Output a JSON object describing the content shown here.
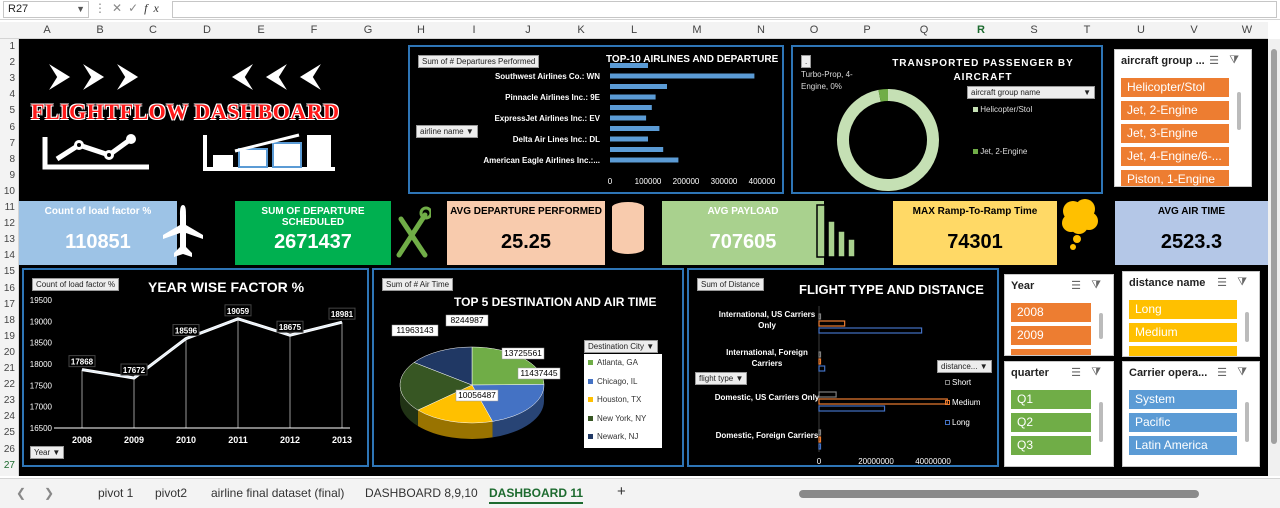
{
  "formula_bar": {
    "name_box": "R27",
    "fx": "fx"
  },
  "columns": [
    "A",
    "B",
    "C",
    "D",
    "E",
    "F",
    "G",
    "H",
    "I",
    "J",
    "K",
    "L",
    "M",
    "N",
    "O",
    "P",
    "Q",
    "R",
    "S",
    "T",
    "U",
    "V",
    "W"
  ],
  "rows": [
    "1",
    "2",
    "3",
    "4",
    "5",
    "6",
    "7",
    "8",
    "9",
    "10",
    "11",
    "12",
    "13",
    "14",
    "15",
    "16",
    "17",
    "18",
    "19",
    "20",
    "21",
    "22",
    "23",
    "24",
    "25",
    "26",
    "27"
  ],
  "tabs": [
    "pivot 1",
    "pivot2",
    "airline final dataset (final)",
    "DASHBOARD 8,9,10",
    "DASHBOARD 11"
  ],
  "active_tab": "DASHBOARD 11",
  "title": "FLIGHTFLOW DASHBOARD",
  "arrows_right": ">>>",
  "arrows_left": "<<<",
  "kpis": [
    {
      "title": "Count of load factor %",
      "value": "110851",
      "bg": "#9dc3e6",
      "fg": "#ffffff"
    },
    {
      "title": "SUM OF DEPARTURE SCHEDULED",
      "value": "2671437",
      "bg": "#00b050",
      "fg": "#ffffff"
    },
    {
      "title": "AVG DEPARTURE PERFORMED",
      "value": "25.25",
      "bg": "#f8cbad",
      "fg": "#000000"
    },
    {
      "title": "AVG PAYLOAD",
      "value": "707605",
      "bg": "#a9d18e",
      "fg": "#ffffff"
    },
    {
      "title": "MAX Ramp-To-Ramp Time",
      "value": "74301",
      "bg": "#ffd966",
      "fg": "#000000"
    },
    {
      "title": "AVG AIR TIME",
      "value": "2523.3",
      "bg": "#b4c7e7",
      "fg": "#000000"
    }
  ],
  "top10": {
    "field_button": "Sum of # Departures Performed",
    "filter_button": "airline name",
    "chart_data": {
      "type": "bar",
      "title": "TOP-10 AIRLINES AND DEPARTURE",
      "categories": [
        "Southwest Airlines Co.: WN",
        "Pinnacle Airlines Inc.: 9E",
        "ExpressJet Airlines Inc.: EV",
        "Delta Air Lines Inc.: DL",
        "American Eagle Airlines Inc.:..."
      ],
      "bars": [
        100000,
        380000,
        150000,
        120000,
        110000,
        95000,
        130000,
        100000,
        140000,
        180000
      ],
      "xticks": [
        "0",
        "100000",
        "200000",
        "300000",
        "400000"
      ],
      "xlim": [
        0,
        400000
      ]
    }
  },
  "donut": {
    "field_button": ".",
    "legend_button": "aircraft group name",
    "chart_data": {
      "type": "pie",
      "title": "TRANSPORTED PASSENGER BY AIRCRAFT",
      "annotation": "Turbo-Prop, 4-Engine, 0%",
      "legend": [
        "Helicopter/Stol",
        "Jet, 2-Engine"
      ],
      "colors": [
        "#c5e0b4",
        "#70ad47"
      ],
      "values": [
        97,
        3
      ]
    }
  },
  "year_chart": {
    "field_button": "Count of load factor %",
    "axis_button": "Year",
    "chart_data": {
      "type": "line",
      "title": "YEAR WISE FACTOR %",
      "x": [
        "2008",
        "2009",
        "2010",
        "2011",
        "2012",
        "2013"
      ],
      "y": [
        17868,
        17672,
        18596,
        19059,
        18675,
        18981
      ],
      "ylim": [
        16500,
        19500
      ],
      "yticks": [
        "19500",
        "19000",
        "18500",
        "18000",
        "17500",
        "17000",
        "16500"
      ]
    }
  },
  "pie3d": {
    "field_button": "Sum of # Air Time",
    "legend_button": "Destination City",
    "chart_data": {
      "type": "pie",
      "title": "TOP 5 DESTINATION AND AIR TIME",
      "categories": [
        "Atlanta, GA",
        "Chicago, IL",
        "Houston, TX",
        "New York, NY",
        "Newark, NJ"
      ],
      "values": [
        13725561,
        11437445,
        10056487,
        11963143,
        8244987
      ],
      "colors": [
        "#70ad47",
        "#4472c4",
        "#ffc000",
        "#375623",
        "#203864"
      ]
    }
  },
  "flight": {
    "field_button": "Sum of Distance",
    "axis_button": "flight type",
    "legend_button": "distance...",
    "chart_data": {
      "type": "bar",
      "title": "FLIGHT TYPE AND DISTANCE",
      "categories": [
        "International, US Carriers Only",
        "International, Foreign Carriers",
        "Domestic, US Carriers Only",
        "Domestic, Foreign Carriers"
      ],
      "series": [
        {
          "name": "Short",
          "values": [
            200000,
            300000,
            6000000,
            200000
          ],
          "color": "#7f7f7f"
        },
        {
          "name": "Medium",
          "values": [
            9000000,
            500000,
            45000000,
            500000
          ],
          "color": "#ed7d31"
        },
        {
          "name": "Long",
          "values": [
            36000000,
            2000000,
            23000000,
            300000
          ],
          "color": "#4472c4"
        }
      ],
      "xticks": [
        "0",
        "20000000",
        "40000000"
      ],
      "xlim": [
        0,
        40000000
      ]
    }
  },
  "slicers": [
    {
      "header": "aircraft group ...",
      "items": [
        "Helicopter/Stol",
        "Jet, 2-Engine",
        "Jet, 3-Engine",
        "Jet, 4-Engine/6-...",
        "Piston, 1-Engine"
      ],
      "color": "#ed7d31"
    },
    {
      "header": "Year",
      "items": [
        "2008",
        "2009",
        ""
      ],
      "color": "#ed7d31"
    },
    {
      "header": "distance name",
      "items": [
        "Long",
        "Medium",
        ""
      ],
      "color": "#ffc000"
    },
    {
      "header": "quarter",
      "items": [
        "Q1",
        "Q2",
        "Q3"
      ],
      "color": "#70ad47"
    },
    {
      "header": "Carrier opera...",
      "items": [
        "System",
        "Pacific",
        "Latin America"
      ],
      "color": "#5b9bd5"
    }
  ]
}
